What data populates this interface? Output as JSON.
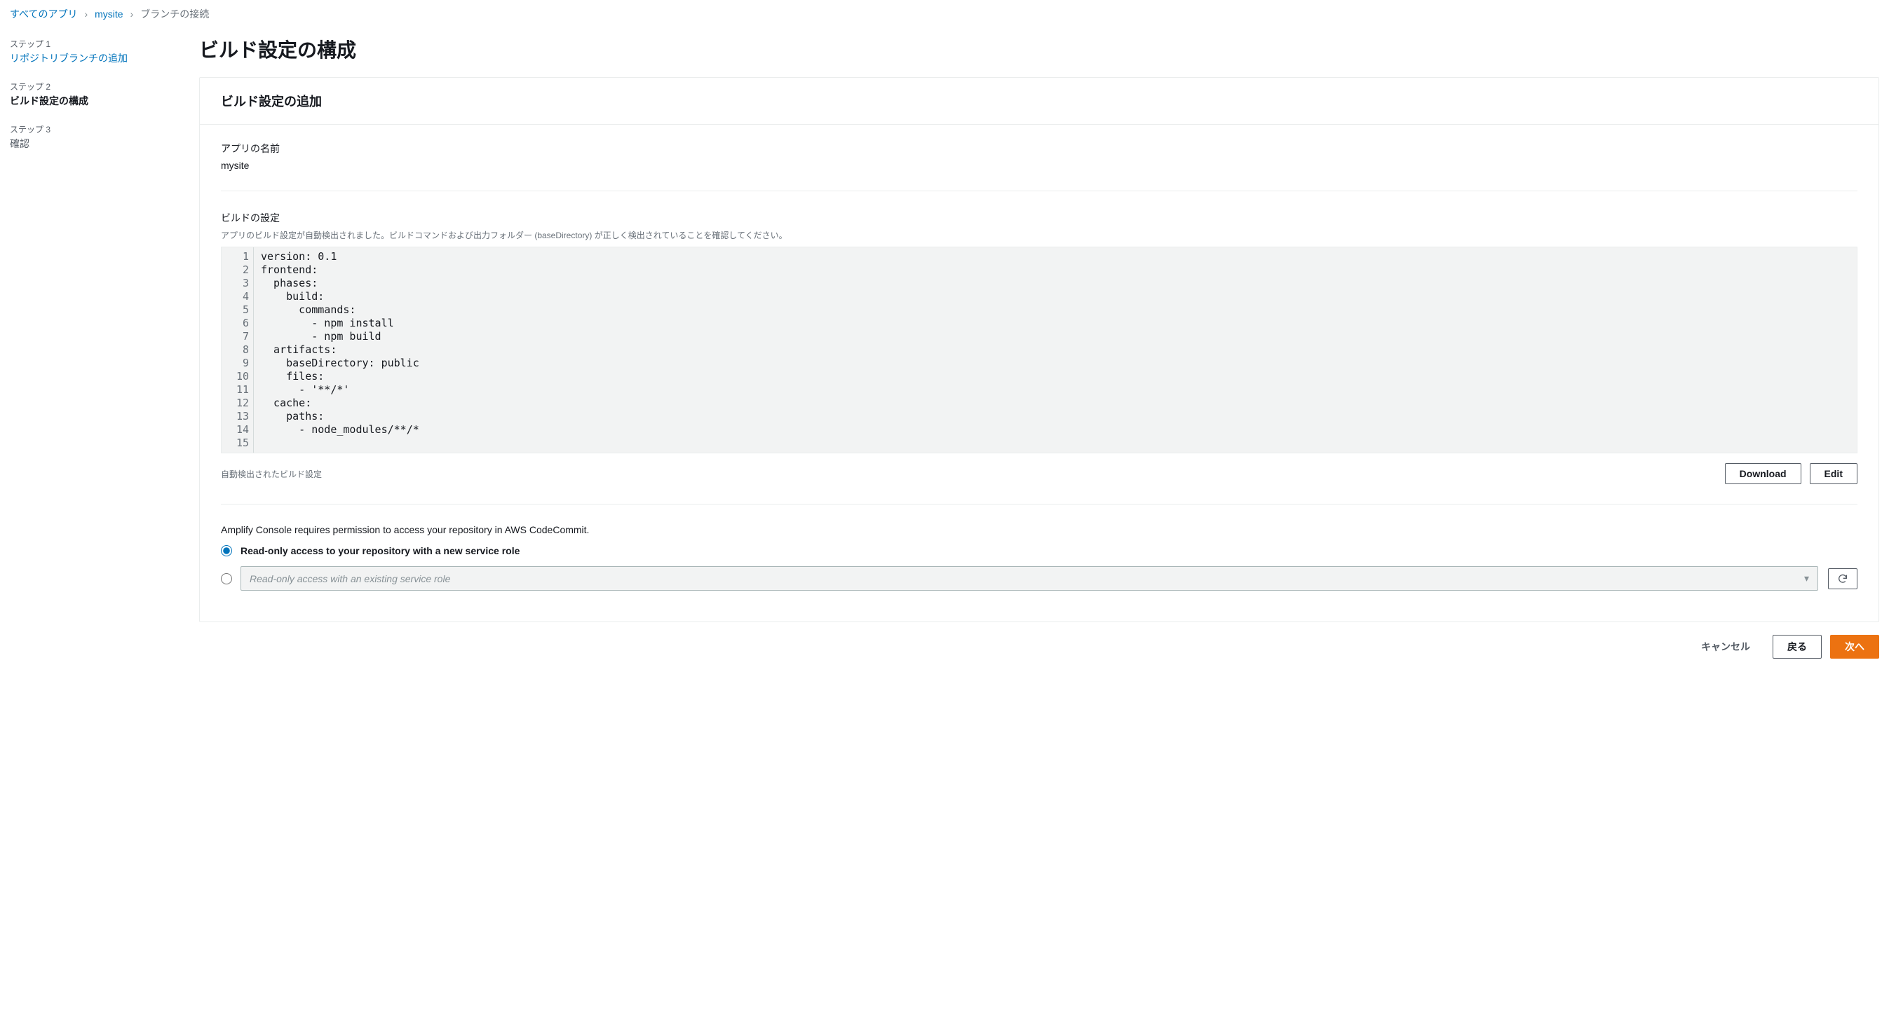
{
  "breadcrumb": {
    "all_apps": "すべてのアプリ",
    "app_name": "mysite",
    "current": "ブランチの接続"
  },
  "sidebar": {
    "steps": [
      {
        "label": "ステップ 1",
        "title": "リポジトリブランチの追加",
        "link": true
      },
      {
        "label": "ステップ 2",
        "title": "ビルド設定の構成",
        "active": true
      },
      {
        "label": "ステップ 3",
        "title": "確認"
      }
    ]
  },
  "page": {
    "title": "ビルド設定の構成"
  },
  "panel": {
    "header": "ビルド設定の追加",
    "app_name_label": "アプリの名前",
    "app_name_value": "mysite",
    "build_settings_label": "ビルドの設定",
    "build_settings_desc": "アプリのビルド設定が自動検出されました。ビルドコマンドおよび出力フォルダー (baseDirectory) が正しく検出されていることを確認してください。",
    "code_lines": [
      "version: 0.1",
      "frontend:",
      "  phases:",
      "    build:",
      "      commands:",
      "        - npm install",
      "        - npm build",
      "  artifacts:",
      "    baseDirectory: public",
      "    files:",
      "      - '**/*'",
      "  cache:",
      "    paths:",
      "      - node_modules/**/*",
      ""
    ],
    "auto_detected_label": "自動検出されたビルド設定",
    "download_label": "Download",
    "edit_label": "Edit",
    "permission_text": "Amplify Console requires permission to access your repository in AWS CodeCommit.",
    "radio_new_role": "Read-only access to your repository with a new service role",
    "select_existing_placeholder": "Read-only access with an existing service role"
  },
  "actions": {
    "cancel": "キャンセル",
    "back": "戻る",
    "next": "次へ"
  }
}
